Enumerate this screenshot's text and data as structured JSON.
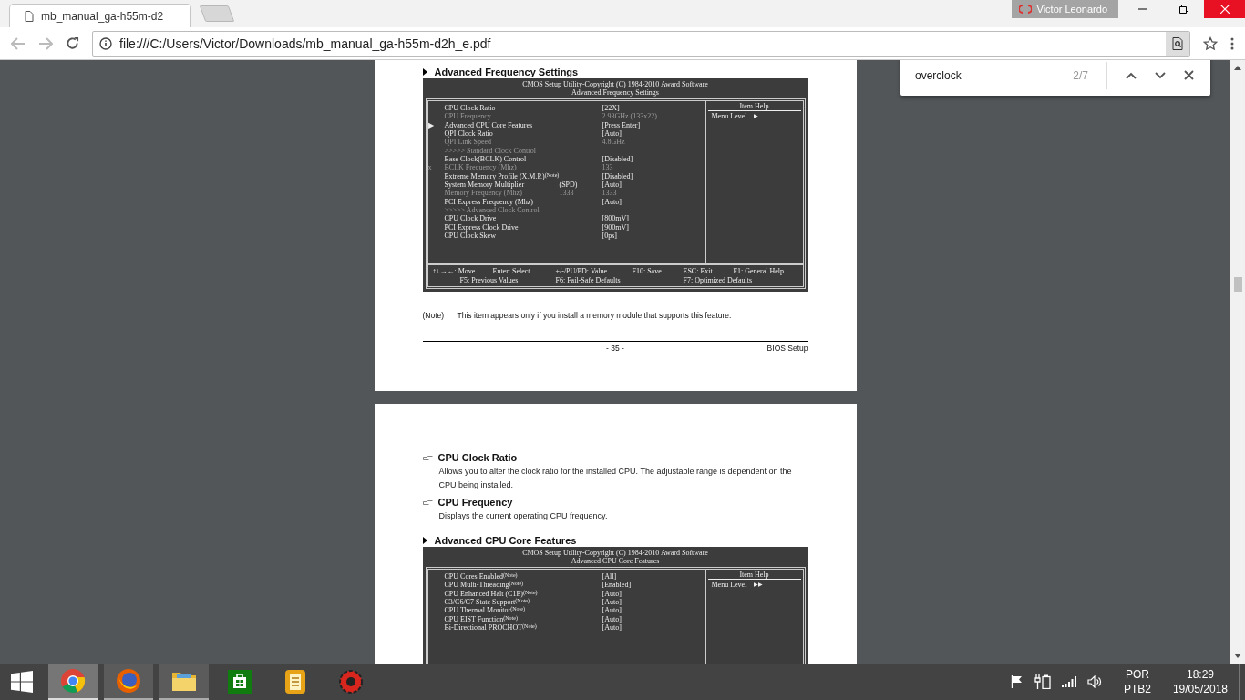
{
  "browser": {
    "tabs": [
      {
        "title": "mb_manual_ga-h55m-d2",
        "selected": true
      }
    ],
    "profile": "Victor Leonardo",
    "address": "file:///C:/Users/Victor/Downloads/mb_manual_ga-h55m-d2h_e.pdf",
    "find": {
      "query": "overclock",
      "count": "2/7"
    }
  },
  "pages": [
    {
      "blocks": [
        {
          "kind": "section",
          "heading": "Advanced Frequency Settings",
          "bios": {
            "title": "CMOS Setup Utility-Copyright (C) 1984-2010 Award Software",
            "subtitle": "Advanced Frequency Settings",
            "help_title": "Item Help",
            "menu_level": "Menu Level",
            "menu_level_arrow": "▶",
            "rows": [
              {
                "label": "CPU Clock Ratio",
                "value": "[22X]",
                "dimmed": false
              },
              {
                "label": "CPU Frequency",
                "value": "2.93GHz (133x22)",
                "dimmed": true
              },
              {
                "marker": "▶",
                "label": "Advanced CPU Core Features",
                "value": "[Press Enter]",
                "dimmed": false
              },
              {
                "label": "QPI Clock Ratio",
                "value": "[Auto]",
                "dimmed": false
              },
              {
                "label": "QPI Link Speed",
                "value": "4.8GHz",
                "dimmed": true
              },
              {
                "label": ">>>>> Standard Clock Control",
                "dimmed": true
              },
              {
                "label": "Base Clock(BCLK) Control",
                "value": "[Disabled]",
                "dimmed": false
              },
              {
                "marker": "x",
                "label": "BCLK Frequency (Mhz)",
                "value": "133",
                "dimmed": true
              },
              {
                "label": "Extreme Memory Profile (X.M.P.)$^{(Note)}$",
                "value": "[Disabled]",
                "dimmed": false
              },
              {
                "label": "System Memory Multiplier",
                "mid": "(SPD)",
                "value": "[Auto]",
                "dimmed": false
              },
              {
                "label": "Memory Frequency (Mhz)",
                "mid": "1333",
                "value": "1333",
                "dimmed": true
              },
              {
                "label": "PCI Express Frequency (Mhz)",
                "value": "[Auto]",
                "dimmed": false
              },
              {
                "label": ">>>>> Advanced Clock Control",
                "dimmed": true
              },
              {
                "label": "CPU Clock Drive",
                "value": "[800mV]",
                "dimmed": false
              },
              {
                "label": "PCI Express Clock Drive",
                "value": "[900mV]",
                "dimmed": false
              },
              {
                "label": "CPU Clock Skew",
                "value": "[0ps]",
                "dimmed": false
              }
            ],
            "keys": [
              [
                "↑↓→←: Move",
                "Enter: Select",
                "+/-/PU/PD: Value",
                "F10: Save",
                "ESC: Exit",
                "F1: General Help"
              ],
              [
                "F5: Previous Values",
                "F6: Fail-Safe Defaults",
                "F7: Optimized Defaults"
              ]
            ]
          }
        },
        {
          "kind": "note",
          "label": "(Note)",
          "text": "This item appears only if you install a memory module that supports this feature."
        },
        {
          "kind": "footer",
          "page_number": "- 35 -",
          "section": "BIOS Setup"
        }
      ]
    },
    {
      "blocks": [
        {
          "kind": "item",
          "heading": "CPU Clock Ratio",
          "description": "Allows you to alter the clock ratio for the installed CPU. The adjustable range is dependent on the CPU being installed."
        },
        {
          "kind": "item",
          "heading": "CPU Frequency",
          "description": "Displays the current operating CPU frequency."
        },
        {
          "kind": "section",
          "heading": "Advanced CPU Core Features",
          "bios": {
            "title": "CMOS Setup Utility-Copyright (C) 1984-2010 Award Software",
            "subtitle": "Advanced CPU Core Features",
            "help_title": "Item Help",
            "menu_level": "Menu Level",
            "menu_level_arrow": "▶▶",
            "rows": [
              {
                "label": "CPU Cores Enabled$^{(Note)}$",
                "value": "[All]",
                "dimmed": false
              },
              {
                "label": "CPU Multi-Threading$^{(Note)}$",
                "value": "[Enabled]",
                "dimmed": false
              },
              {
                "label": "CPU Enhanced Halt (C1E)$^{(Note)}$",
                "value": "[Auto]",
                "dimmed": false
              },
              {
                "label": "C3/C6/C7 State Support$^{(Note)}$",
                "value": "[Auto]",
                "dimmed": false
              },
              {
                "label": "CPU Thermal Monitor$^{(Note)}$",
                "value": "[Auto]",
                "dimmed": false
              },
              {
                "label": "CPU EIST Function$^{(Note)}$",
                "value": "[Auto]",
                "dimmed": false
              },
              {
                "label": "Bi-Directional PROCHOT$^{(Note)}$",
                "value": "[Auto]",
                "dimmed": false
              }
            ]
          }
        }
      ]
    }
  ],
  "taskbar": {
    "apps": [
      {
        "kind": "browser",
        "running": true,
        "selected": true
      },
      {
        "kind": "fox",
        "running": true,
        "selected": false
      },
      {
        "kind": "folder",
        "running": true,
        "selected": false
      },
      {
        "kind": "store",
        "running": false,
        "selected": false
      },
      {
        "kind": "notes",
        "running": false,
        "selected": false
      },
      {
        "kind": "gear",
        "running": false,
        "selected": false
      }
    ],
    "language": "POR",
    "layout": "PTB2",
    "time": "18:29",
    "date": "19/05/2018"
  }
}
